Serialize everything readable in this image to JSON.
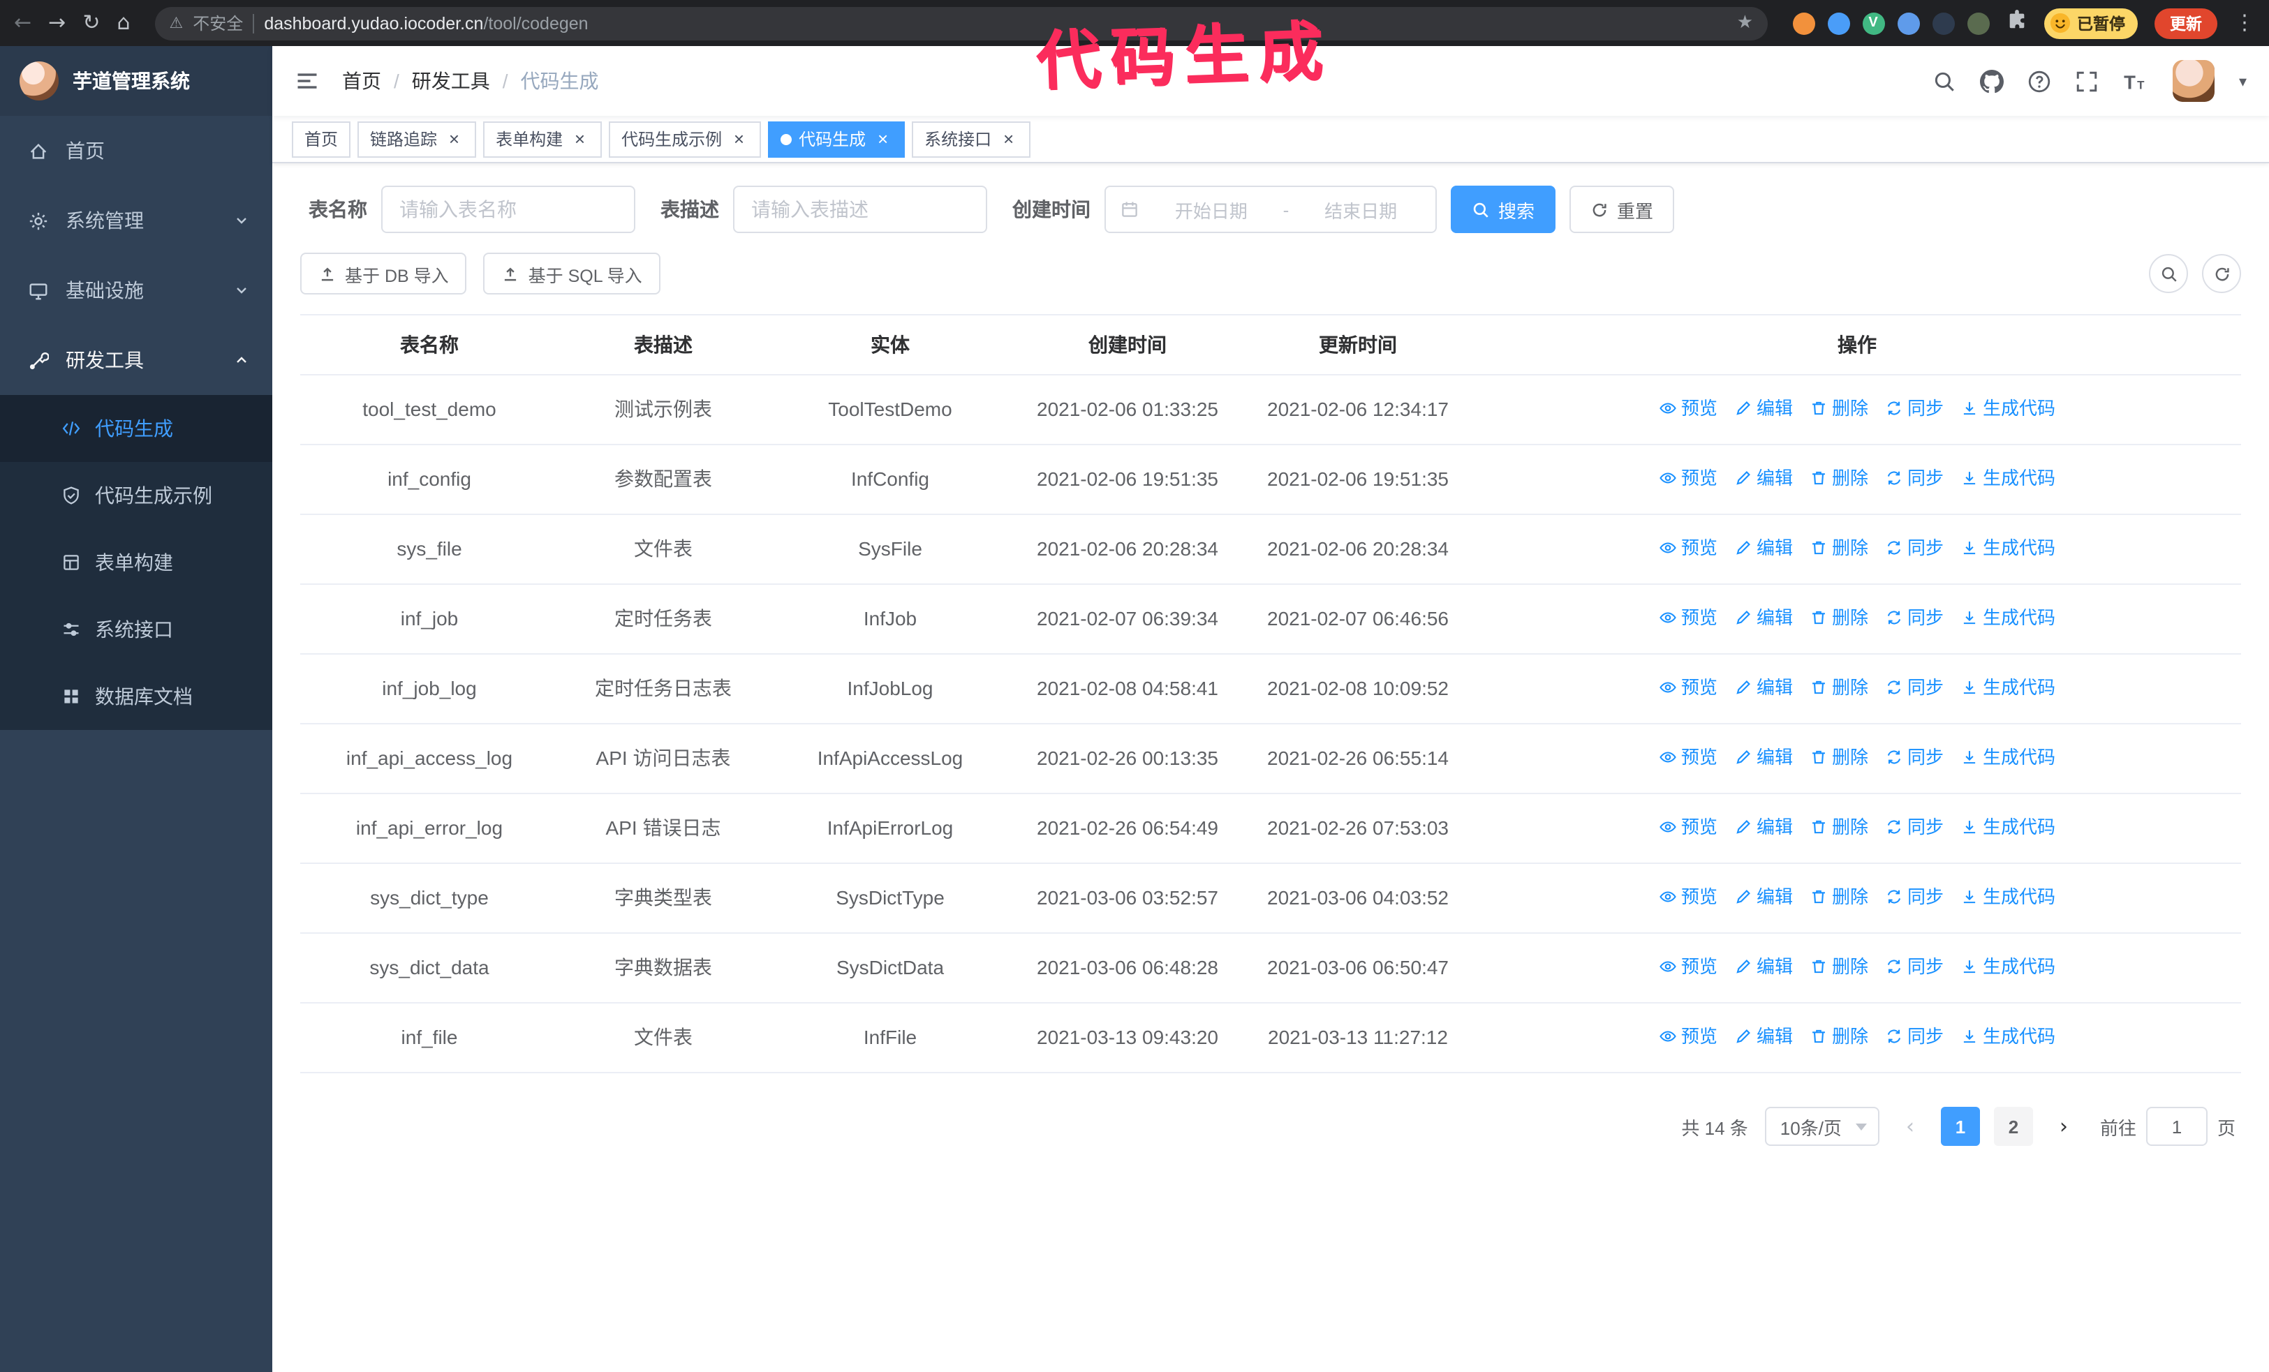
{
  "annotation": {
    "text": "代码生成"
  },
  "colors": {
    "primary": "#409eff",
    "link": "#1890ff",
    "annotation": "#fb2c5c",
    "sidebar_bg": "#304156",
    "submenu_bg": "#1f2d3d",
    "update_button_bg": "#e1462d",
    "paused_badge_bg": "#fcd667"
  },
  "icons": {
    "back": "←",
    "forward": "→",
    "reload": "↻",
    "home": "⌂",
    "warning": "⚠",
    "star": "★",
    "kebab": "⋮",
    "page_prev": "‹",
    "page_next": "›",
    "caret_down": "▾"
  },
  "browser": {
    "security_text": "不安全",
    "url_domain": "dashboard.yudao.iocoder.cn",
    "url_path": "/tool/codegen",
    "paused_badge": "已暂停",
    "update_button": "更新",
    "extensions": [
      {
        "name": "orange",
        "color": "#f2913c",
        "letter": ""
      },
      {
        "name": "blue",
        "color": "#4a9df8",
        "letter": ""
      },
      {
        "name": "vue-devtools",
        "color": "#41b883",
        "letter": "V"
      },
      {
        "name": "duo",
        "color": "#5f9bea",
        "letter": ""
      },
      {
        "name": "capture",
        "color": "#2e3b4e",
        "letter": ""
      },
      {
        "name": "mono",
        "color": "#5a6b4f",
        "letter": ""
      }
    ]
  },
  "sidebar": {
    "logo_title": "芋道管理系统",
    "items": [
      {
        "label": "首页"
      },
      {
        "label": "系统管理"
      },
      {
        "label": "基础设施"
      },
      {
        "label": "研发工具"
      }
    ],
    "submenu": [
      {
        "label": "代码生成",
        "active": true
      },
      {
        "label": "代码生成示例"
      },
      {
        "label": "表单构建"
      },
      {
        "label": "系统接口"
      },
      {
        "label": "数据库文档"
      }
    ]
  },
  "breadcrumb": [
    "首页",
    "研发工具",
    "代码生成"
  ],
  "tabs": [
    {
      "label": "首页",
      "closable": false,
      "active": false
    },
    {
      "label": "链路追踪",
      "closable": true,
      "active": false
    },
    {
      "label": "表单构建",
      "closable": true,
      "active": false
    },
    {
      "label": "代码生成示例",
      "closable": true,
      "active": false
    },
    {
      "label": "代码生成",
      "closable": true,
      "active": true
    },
    {
      "label": "系统接口",
      "closable": true,
      "active": false
    }
  ],
  "filters": {
    "table_name_label": "表名称",
    "table_name_placeholder": "请输入表名称",
    "table_desc_label": "表描述",
    "table_desc_placeholder": "请输入表描述",
    "create_time_label": "创建时间",
    "date_start_placeholder": "开始日期",
    "date_separator": "-",
    "date_end_placeholder": "结束日期",
    "search_button": "搜索",
    "reset_button": "重置"
  },
  "toolbar": {
    "import_db": "基于 DB 导入",
    "import_sql": "基于 SQL 导入"
  },
  "table": {
    "columns": [
      "表名称",
      "表描述",
      "实体",
      "创建时间",
      "更新时间",
      "操作"
    ],
    "actions": [
      "预览",
      "编辑",
      "删除",
      "同步",
      "生成代码"
    ],
    "rows": [
      {
        "name": "tool_test_demo",
        "desc": "测试示例表",
        "entity": "ToolTestDemo",
        "created": "2021-02-06 01:33:25",
        "updated": "2021-02-06 12:34:17"
      },
      {
        "name": "inf_config",
        "desc": "参数配置表",
        "entity": "InfConfig",
        "created": "2021-02-06 19:51:35",
        "updated": "2021-02-06 19:51:35"
      },
      {
        "name": "sys_file",
        "desc": "文件表",
        "entity": "SysFile",
        "created": "2021-02-06 20:28:34",
        "updated": "2021-02-06 20:28:34"
      },
      {
        "name": "inf_job",
        "desc": "定时任务表",
        "entity": "InfJob",
        "created": "2021-02-07 06:39:34",
        "updated": "2021-02-07 06:46:56"
      },
      {
        "name": "inf_job_log",
        "desc": "定时任务日志表",
        "entity": "InfJobLog",
        "created": "2021-02-08 04:58:41",
        "updated": "2021-02-08 10:09:52"
      },
      {
        "name": "inf_api_access_log",
        "desc": "API 访问日志表",
        "entity": "InfApiAccessLog",
        "created": "2021-02-26 00:13:35",
        "updated": "2021-02-26 06:55:14"
      },
      {
        "name": "inf_api_error_log",
        "desc": "API 错误日志",
        "entity": "InfApiErrorLog",
        "created": "2021-02-26 06:54:49",
        "updated": "2021-02-26 07:53:03"
      },
      {
        "name": "sys_dict_type",
        "desc": "字典类型表",
        "entity": "SysDictType",
        "created": "2021-03-06 03:52:57",
        "updated": "2021-03-06 04:03:52"
      },
      {
        "name": "sys_dict_data",
        "desc": "字典数据表",
        "entity": "SysDictData",
        "created": "2021-03-06 06:48:28",
        "updated": "2021-03-06 06:50:47"
      },
      {
        "name": "inf_file",
        "desc": "文件表",
        "entity": "InfFile",
        "created": "2021-03-13 09:43:20",
        "updated": "2021-03-13 11:27:12"
      }
    ]
  },
  "pagination": {
    "total": "共 14 条",
    "page_size": "10条/页",
    "pages": [
      "1",
      "2"
    ],
    "active_page": "1",
    "goto_label": "前往",
    "goto_value": "1",
    "goto_suffix": "页"
  }
}
